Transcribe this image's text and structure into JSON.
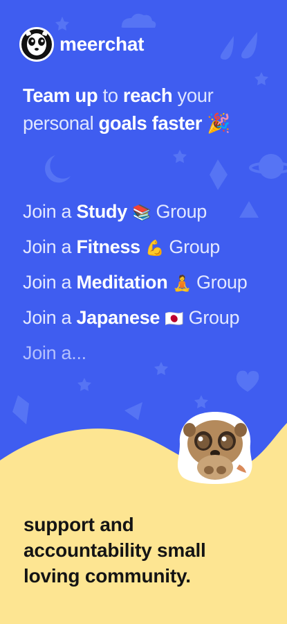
{
  "brand": {
    "name": "meerchat",
    "logo_icon": "meerkat-logo-icon"
  },
  "headline": {
    "line1": [
      {
        "text": "Team up",
        "style": "bold"
      },
      {
        "text": " to ",
        "style": "light"
      },
      {
        "text": "reach",
        "style": "bold"
      },
      {
        "text": " your",
        "style": "light"
      }
    ],
    "line2": [
      {
        "text": "personal ",
        "style": "light"
      },
      {
        "text": "goals faster",
        "style": "bold"
      },
      {
        "text": " 🎉",
        "style": "emoji"
      }
    ]
  },
  "groups": [
    {
      "prefix": "Join a ",
      "name": "Study",
      "emoji": "📚",
      "suffix": "Group"
    },
    {
      "prefix": "Join a ",
      "name": "Fitness",
      "emoji": "💪",
      "suffix": "Group"
    },
    {
      "prefix": "Join a ",
      "name": "Meditation",
      "emoji": "🧘",
      "suffix": "Group"
    },
    {
      "prefix": "Join a ",
      "name": "Japanese",
      "emoji": "🇯🇵",
      "suffix": "Group"
    },
    {
      "prefix": "Join a...",
      "name": "",
      "emoji": "",
      "suffix": ""
    }
  ],
  "tagline": {
    "lines": [
      "support and",
      "accountability small",
      "loving community."
    ]
  },
  "colors": {
    "background": "#3f5df0",
    "bottom_panel": "#fde592",
    "deco": "#5876f5"
  }
}
